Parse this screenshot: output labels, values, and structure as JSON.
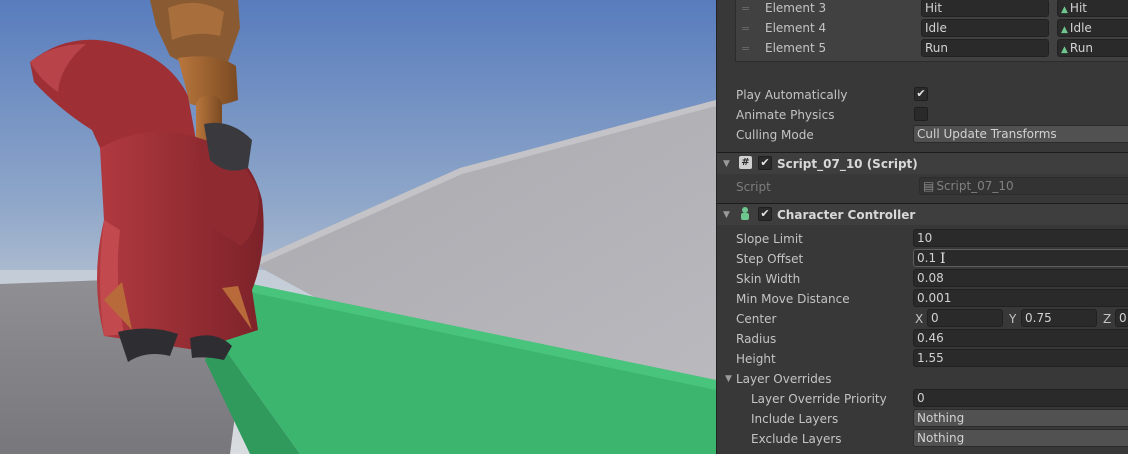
{
  "animation": {
    "elements": [
      {
        "label": "Element 3",
        "name_value": "Hit",
        "clip": "Hit"
      },
      {
        "label": "Element 4",
        "name_value": "Idle",
        "clip": "Idle"
      },
      {
        "label": "Element 5",
        "name_value": "Run",
        "clip": "Run"
      }
    ],
    "play_automatically": {
      "label": "Play Automatically",
      "checked": true
    },
    "animate_physics": {
      "label": "Animate Physics",
      "checked": false
    },
    "culling_mode": {
      "label": "Culling Mode",
      "value": "Cull Update Transforms"
    }
  },
  "script_component": {
    "title": "Script_07_10 (Script)",
    "script_label": "Script",
    "script_value": "Script_07_10",
    "enabled": true
  },
  "character_controller": {
    "title": "Character Controller",
    "enabled": true,
    "slope_limit": {
      "label": "Slope Limit",
      "value": "10"
    },
    "step_offset": {
      "label": "Step Offset",
      "value": "0.1"
    },
    "skin_width": {
      "label": "Skin Width",
      "value": "0.08"
    },
    "min_move_distance": {
      "label": "Min Move Distance",
      "value": "0.001"
    },
    "center": {
      "label": "Center",
      "x_label": "X",
      "x": "0",
      "y_label": "Y",
      "y": "0.75",
      "z_label": "Z",
      "z": "0"
    },
    "radius": {
      "label": "Radius",
      "value": "0.46"
    },
    "height": {
      "label": "Height",
      "value": "1.55"
    },
    "layer_overrides": {
      "label": "Layer Overrides",
      "priority": {
        "label": "Layer Override Priority",
        "value": "0"
      },
      "include": {
        "label": "Include Layers",
        "value": "Nothing"
      },
      "exclude": {
        "label": "Exclude Layers",
        "value": "Nothing"
      }
    }
  },
  "icons": {
    "checkmark": "✔",
    "foldout_open": "▼",
    "hash": "#",
    "drag_handle": "=",
    "clip": "▲",
    "script_file": "▤",
    "text_cursor": "I"
  },
  "colors": {
    "sky_top": "#5a7ec0",
    "sky_bottom": "#cfd6dc",
    "ground_green": "#3cb56f",
    "wall_grey": "#b3b3b8",
    "robe_red": "#9d2f35",
    "inspector_bg": "#383838",
    "field_bg": "#2a2a2a"
  }
}
